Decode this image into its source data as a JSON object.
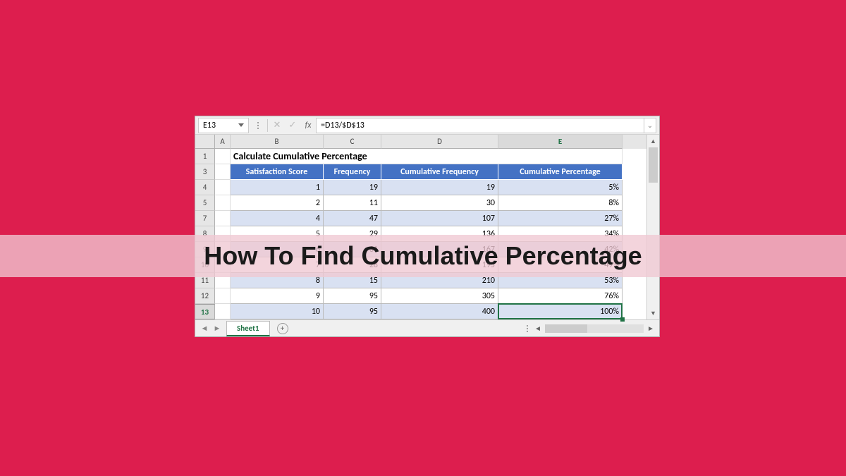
{
  "banner": {
    "title": "How To Find Cumulative Percentage"
  },
  "namebox": {
    "value": "E13"
  },
  "formula": {
    "value": "=D13/$D$13"
  },
  "title_row": {
    "text": "Calculate Cumulative Percentage"
  },
  "columns": [
    "A",
    "B",
    "C",
    "D",
    "E"
  ],
  "row_numbers": [
    "1",
    "3",
    "4",
    "5",
    "7",
    "8",
    "9",
    "10",
    "11",
    "12",
    "13"
  ],
  "headers": {
    "b": "Satisfaction Score",
    "c": "Frequency",
    "d": "Cumulative Frequency",
    "e": "Cumulative Percentage"
  },
  "rows": [
    {
      "b": "1",
      "c": "19",
      "d": "19",
      "e": "5%"
    },
    {
      "b": "2",
      "c": "11",
      "d": "30",
      "e": "8%"
    },
    {
      "b": "4",
      "c": "47",
      "d": "107",
      "e": "27%"
    },
    {
      "b": "5",
      "c": "29",
      "d": "136",
      "e": "34%"
    },
    {
      "b": "6",
      "c": "31",
      "d": "167",
      "e": "42%"
    },
    {
      "b": "7",
      "c": "28",
      "d": "195",
      "e": "49%"
    },
    {
      "b": "8",
      "c": "15",
      "d": "210",
      "e": "53%"
    },
    {
      "b": "9",
      "c": "95",
      "d": "305",
      "e": "76%"
    },
    {
      "b": "10",
      "c": "95",
      "d": "400",
      "e": "100%"
    }
  ],
  "sheet": {
    "name": "Sheet1"
  },
  "chart_data": {
    "type": "table",
    "title": "Calculate Cumulative Percentage",
    "columns": [
      "Satisfaction Score",
      "Frequency",
      "Cumulative Frequency",
      "Cumulative Percentage"
    ],
    "rows": [
      [
        1,
        19,
        19,
        "5%"
      ],
      [
        2,
        11,
        30,
        "8%"
      ],
      [
        4,
        47,
        107,
        "27%"
      ],
      [
        5,
        29,
        136,
        "34%"
      ],
      [
        6,
        31,
        167,
        "42%"
      ],
      [
        7,
        28,
        195,
        "49%"
      ],
      [
        8,
        15,
        210,
        "53%"
      ],
      [
        9,
        95,
        305,
        "76%"
      ],
      [
        10,
        95,
        400,
        "100%"
      ]
    ]
  }
}
